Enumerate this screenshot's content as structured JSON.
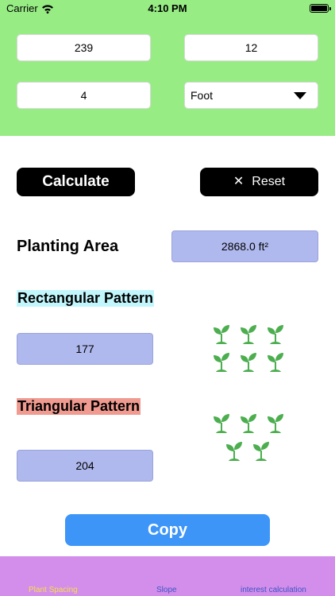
{
  "status_bar": {
    "carrier": "Carrier",
    "time": "4:10 PM"
  },
  "inputs": {
    "length": "239",
    "width": "12",
    "spacing": "4",
    "unit_selected": "Foot"
  },
  "actions": {
    "calculate_label": "Calculate",
    "reset_label": "Reset",
    "copy_label": "Copy"
  },
  "results": {
    "area_label": "Planting Area",
    "area_value": "2868.0 ft²",
    "rect_title": "Rectangular Pattern",
    "rect_value": "177",
    "tri_title": "Triangular Pattern",
    "tri_value": "204"
  },
  "tabs": [
    {
      "label": "Plant Spacing",
      "active": true
    },
    {
      "label": "Slope",
      "active": false
    },
    {
      "label": "interest calculation",
      "active": false
    }
  ],
  "colors": {
    "header_green": "#97ec84",
    "result_box": "#b0b9ee",
    "rect_highlight": "#c2f6fd",
    "tri_highlight": "#f09a90",
    "copy_blue": "#3d95f8",
    "tab_bar": "#d38dea",
    "tab_active": "#f7e04a",
    "tab_inactive": "#3b55c6",
    "sprout_green": "#4cae4f"
  }
}
